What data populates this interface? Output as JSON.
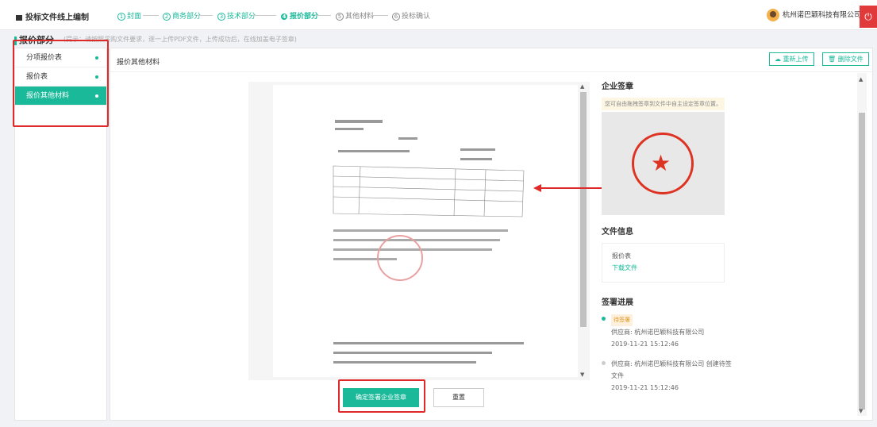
{
  "header": {
    "app_title": "投标文件线上编制",
    "steps": [
      {
        "label": "封面",
        "num": "1",
        "state": "done"
      },
      {
        "label": "商务部分",
        "num": "2",
        "state": "done"
      },
      {
        "label": "技术部分",
        "num": "3",
        "state": "done"
      },
      {
        "label": "报价部分",
        "num": "4",
        "state": "active"
      },
      {
        "label": "其他材料",
        "num": "5",
        "state": "pending"
      },
      {
        "label": "投标确认",
        "num": "6",
        "state": "pending"
      }
    ],
    "company": "杭州诺巴颖科技有限公司",
    "power_icon": "power-icon"
  },
  "section": {
    "title": "报价部分",
    "tip": "(提示：请按照采购文件要求，逐一上传PDF文件，上传成功后，在线加盖电子签章)"
  },
  "sidebar": {
    "items": [
      {
        "label": "分项报价表",
        "active": false
      },
      {
        "label": "报价表",
        "active": false
      },
      {
        "label": "报价其他材料",
        "active": true
      }
    ]
  },
  "main": {
    "title": "报价其他材料",
    "reupload": "重新上传",
    "delete": "删除文件"
  },
  "right": {
    "seal_title": "企业签章",
    "seal_tip": "您可自由拖拽签章到文件中自主设定签章位置。",
    "file_info_title": "文件信息",
    "file_name": "报价表",
    "download": "下载文件",
    "progress_title": "签署进展",
    "timeline": [
      {
        "tag": "待签署",
        "line1": "供应商: 杭州诺巴颖科技有限公司",
        "time": "2019-11-21 15:12:46"
      },
      {
        "tag": "",
        "line1": "供应商: 杭州诺巴颖科技有限公司 创建待签",
        "line2": "文件",
        "time": "2019-11-21 15:12:46"
      }
    ]
  },
  "actions": {
    "confirm": "确定签署企业签章",
    "reset": "重置"
  },
  "colors": {
    "accent": "#19b99a",
    "danger": "#e02a2a",
    "warn_bg": "#fdf6e3"
  }
}
